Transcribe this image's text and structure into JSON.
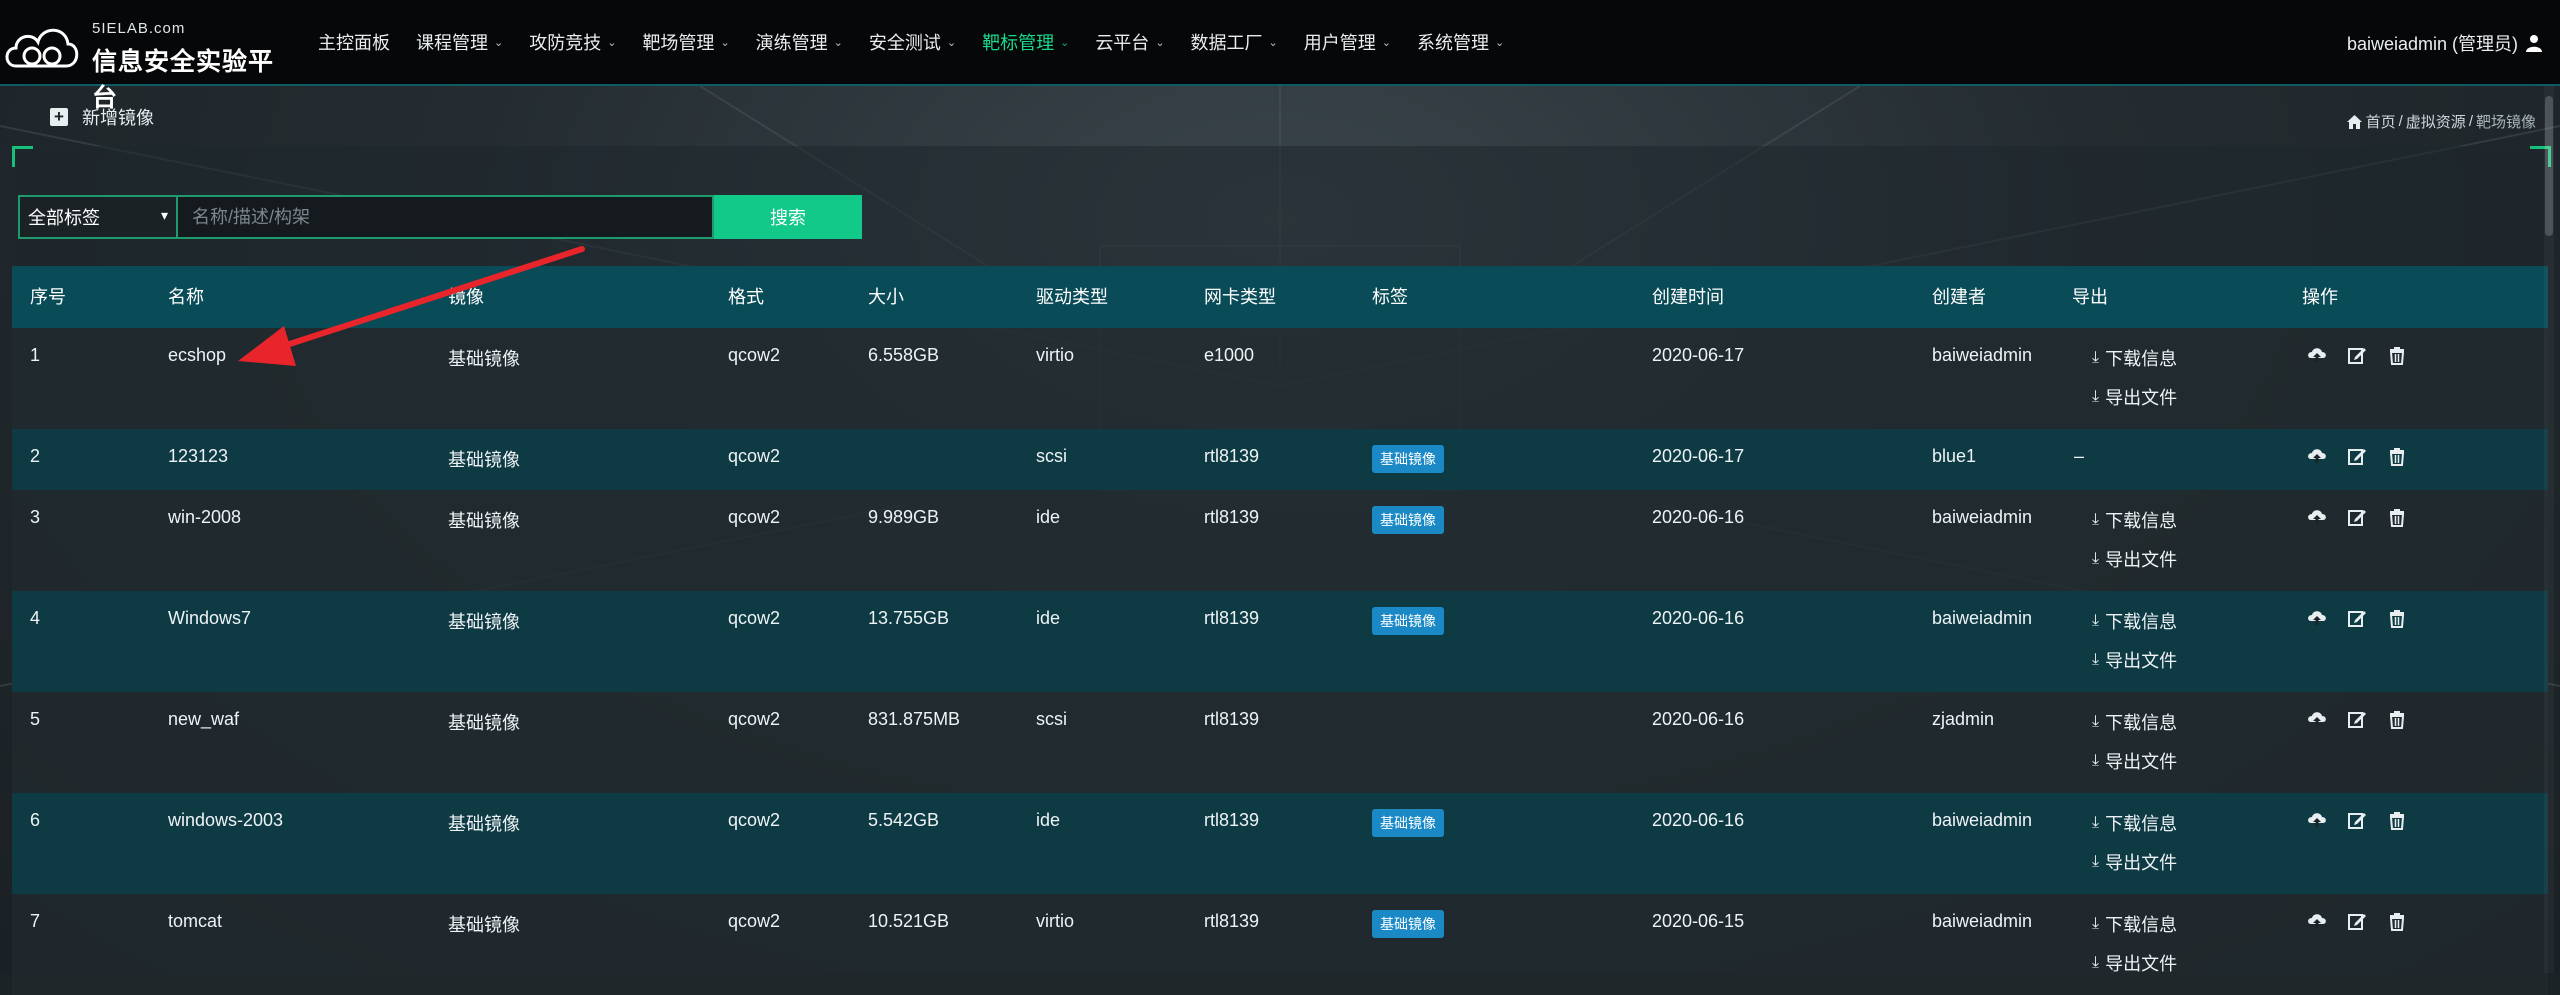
{
  "brand": {
    "small": "5IELAB.com",
    "big": "信息安全实验平台"
  },
  "nav": [
    {
      "label": "主控面板",
      "dropdown": false,
      "active": false
    },
    {
      "label": "课程管理",
      "dropdown": true,
      "active": false
    },
    {
      "label": "攻防竞技",
      "dropdown": true,
      "active": false
    },
    {
      "label": "靶场管理",
      "dropdown": true,
      "active": false
    },
    {
      "label": "演练管理",
      "dropdown": true,
      "active": false
    },
    {
      "label": "安全测试",
      "dropdown": true,
      "active": false
    },
    {
      "label": "靶标管理",
      "dropdown": true,
      "active": true
    },
    {
      "label": "云平台",
      "dropdown": true,
      "active": false
    },
    {
      "label": "数据工厂",
      "dropdown": true,
      "active": false
    },
    {
      "label": "用户管理",
      "dropdown": true,
      "active": false
    },
    {
      "label": "系统管理",
      "dropdown": true,
      "active": false
    }
  ],
  "user": {
    "name": "baiweiadmin (管理员)"
  },
  "toolbar": {
    "add_label": "新增镜像"
  },
  "breadcrumb": {
    "home": "首页",
    "section": "虚拟资源",
    "current": "靶场镜像"
  },
  "search": {
    "filter": "全部标签",
    "placeholder": "名称/描述/构架",
    "button": "搜索"
  },
  "table": {
    "headers": {
      "no": "序号",
      "name": "名称",
      "type": "镜像",
      "format": "格式",
      "size": "大小",
      "driver": "驱动类型",
      "nic": "网卡类型",
      "tag": "标签",
      "created": "创建时间",
      "creator": "创建者",
      "export": "导出",
      "ops": "操作"
    },
    "export_labels": {
      "download": "下载信息",
      "export": "导出文件"
    },
    "rows": [
      {
        "no": "1",
        "name": "ecshop",
        "type": "基础镜像",
        "format": "qcow2",
        "size": "6.558GB",
        "driver": "virtio",
        "nic": "e1000",
        "tag": "",
        "created": "2020-06-17",
        "creator": "baiweiadmin",
        "export": "both"
      },
      {
        "no": "2",
        "name": "123123",
        "type": "基础镜像",
        "format": "qcow2",
        "size": "",
        "driver": "scsi",
        "nic": "rtl8139",
        "tag": "基础镜像",
        "created": "2020-06-17",
        "creator": "blue1",
        "export": "–"
      },
      {
        "no": "3",
        "name": "win-2008",
        "type": "基础镜像",
        "format": "qcow2",
        "size": "9.989GB",
        "driver": "ide",
        "nic": "rtl8139",
        "tag": "基础镜像",
        "created": "2020-06-16",
        "creator": "baiweiadmin",
        "export": "both"
      },
      {
        "no": "4",
        "name": "Windows7",
        "type": "基础镜像",
        "format": "qcow2",
        "size": "13.755GB",
        "driver": "ide",
        "nic": "rtl8139",
        "tag": "基础镜像",
        "created": "2020-06-16",
        "creator": "baiweiadmin",
        "export": "both"
      },
      {
        "no": "5",
        "name": "new_waf",
        "type": "基础镜像",
        "format": "qcow2",
        "size": "831.875MB",
        "driver": "scsi",
        "nic": "rtl8139",
        "tag": "",
        "created": "2020-06-16",
        "creator": "zjadmin",
        "export": "both"
      },
      {
        "no": "6",
        "name": "windows-2003",
        "type": "基础镜像",
        "format": "qcow2",
        "size": "5.542GB",
        "driver": "ide",
        "nic": "rtl8139",
        "tag": "基础镜像",
        "created": "2020-06-16",
        "creator": "baiweiadmin",
        "export": "both"
      },
      {
        "no": "7",
        "name": "tomcat",
        "type": "基础镜像",
        "format": "qcow2",
        "size": "10.521GB",
        "driver": "virtio",
        "nic": "rtl8139",
        "tag": "基础镜像",
        "created": "2020-06-15",
        "creator": "baiweiadmin",
        "export": "both"
      }
    ]
  },
  "colors": {
    "accent": "#12c98a",
    "active_nav": "#19d98c",
    "header_bg": "#0a4b58",
    "row_alt": "#0e3a44",
    "tag_bg": "#1a89c6",
    "arrow": "#e8252a"
  }
}
